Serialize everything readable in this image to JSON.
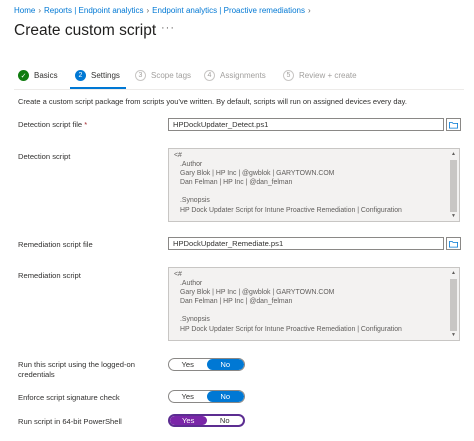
{
  "breadcrumb": [
    "Home",
    "Reports | Endpoint analytics",
    "Endpoint analytics | Proactive remediations"
  ],
  "title": "Create custom script",
  "more": "···",
  "steps": [
    {
      "label": "Basics",
      "num": "✓",
      "state": "done"
    },
    {
      "label": "Settings",
      "num": "2",
      "state": "active"
    },
    {
      "label": "Scope tags",
      "num": "3",
      "state": "future"
    },
    {
      "label": "Assignments",
      "num": "4",
      "state": "future"
    },
    {
      "label": "Review + create",
      "num": "5",
      "state": "future"
    }
  ],
  "intro": "Create a custom script package from scripts you've written. By default, scripts will run on assigned devices every day.",
  "detection_file": {
    "label": "Detection script file",
    "required": "*",
    "value": "HPDockUpdater_Detect.ps1"
  },
  "detection_script": {
    "label": "Detection script",
    "lines": [
      "<#",
      ".Author",
      "Gary Blok | HP Inc | @gwblok | GARYTOWN.COM",
      "Dan Felman | HP Inc | @dan_felman",
      "",
      ".Synopsis",
      "HP Dock Updater Script for Intune Proactive Remediation | Configuration"
    ]
  },
  "remediation_file": {
    "label": "Remediation script file",
    "value": "HPDockUpdater_Remediate.ps1"
  },
  "remediation_script": {
    "label": "Remediation script",
    "lines": [
      "<#",
      ".Author",
      "Gary Blok | HP Inc | @gwblok | GARYTOWN.COM",
      "Dan Felman | HP Inc | @dan_felman",
      "",
      ".Synopsis",
      "HP Dock Updater Script for Intune Proactive Remediation | Configuration"
    ]
  },
  "run_logged_on": {
    "label_line1": "Run this script using the logged-on",
    "label_line2": "credentials",
    "yes": "Yes",
    "no": "No",
    "selected": "No"
  },
  "enforce_signature": {
    "label": "Enforce script signature check",
    "yes": "Yes",
    "no": "No",
    "selected": "No"
  },
  "run_64bit": {
    "label": "Run script in 64-bit PowerShell",
    "yes": "Yes",
    "no": "No",
    "selected": "Yes"
  },
  "colors": {
    "accent": "#0078d4",
    "done": "#107c10",
    "highlight": "#7a26a8"
  }
}
